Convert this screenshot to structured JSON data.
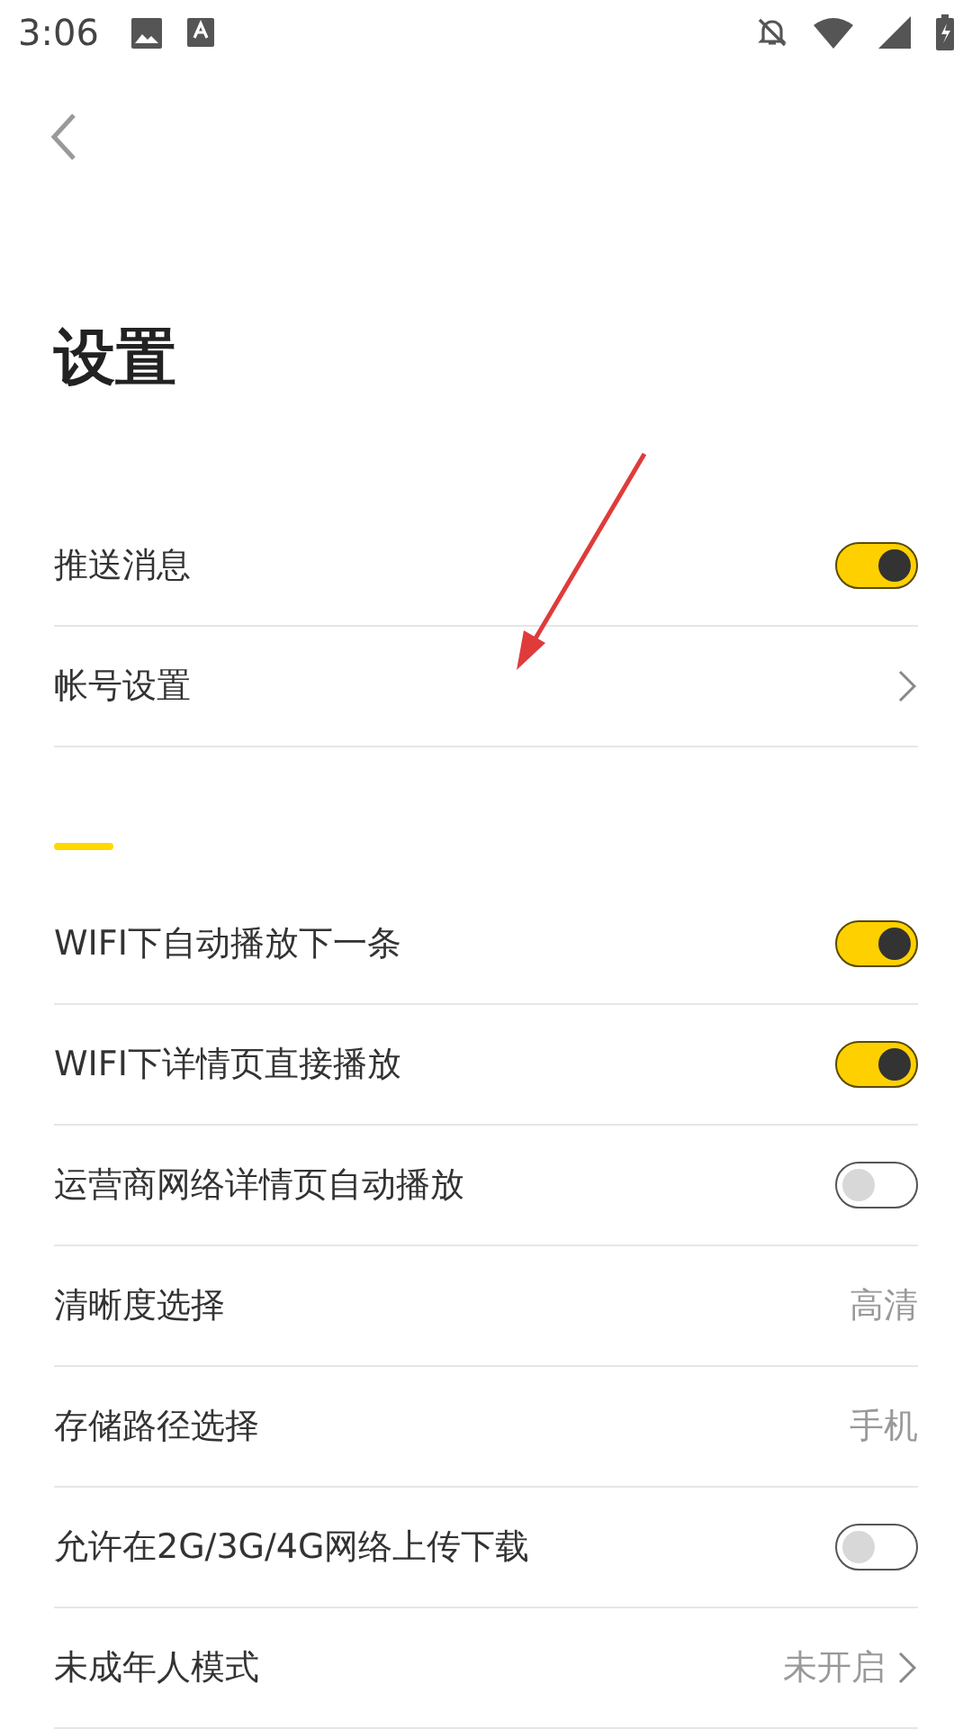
{
  "status_bar": {
    "time": "3:06"
  },
  "title": "设置",
  "sections": [
    {
      "items": [
        {
          "kind": "toggle",
          "label": "推送消息",
          "on": true
        },
        {
          "kind": "link",
          "label": "帐号设置"
        }
      ]
    },
    {
      "items": [
        {
          "kind": "toggle",
          "label": "WIFI下自动播放下一条",
          "on": true
        },
        {
          "kind": "toggle",
          "label": "WIFI下详情页直接播放",
          "on": true
        },
        {
          "kind": "toggle",
          "label": "运营商网络详情页自动播放",
          "on": false
        },
        {
          "kind": "value",
          "label": "清晰度选择",
          "value": "高清"
        },
        {
          "kind": "value",
          "label": "存储路径选择",
          "value": "手机"
        },
        {
          "kind": "toggle",
          "label": "允许在2G/3G/4G网络上传下载",
          "on": false
        },
        {
          "kind": "link",
          "label": "未成年人模式",
          "value": "未开启"
        }
      ]
    }
  ]
}
